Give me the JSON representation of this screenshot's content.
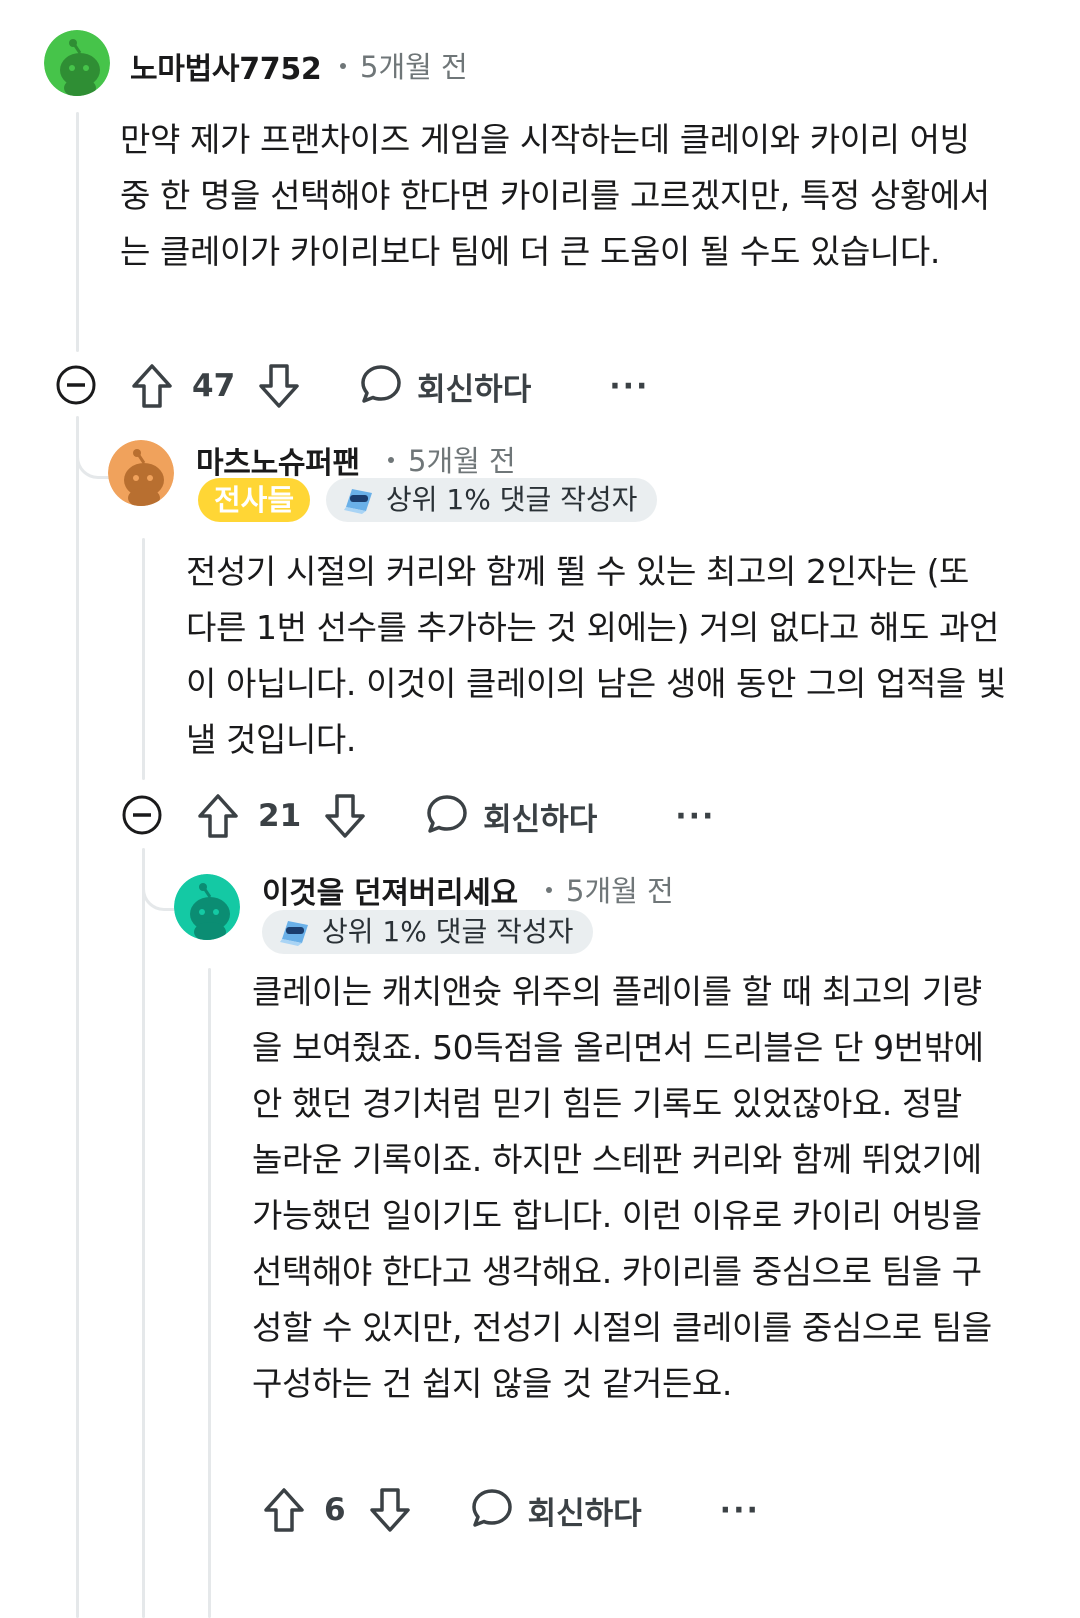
{
  "comments": [
    {
      "username": "노마법사7752",
      "time": "5개월 전",
      "body": "만약 제가 프랜차이즈 게임을 시작하는데 클레이와 카이리 어빙 중 한 명을 선택해야 한다면 카이리를 고르겠지만, 특정 상황에서는 클레이가 카이리보다 팀에 더 큰 도움이 될 수도 있습니다.",
      "votes": "47",
      "reply_label": "회신하다",
      "more_label": "···",
      "avatar_color": "#46c44a"
    },
    {
      "username": "마츠노슈퍼팬",
      "time": "5개월 전",
      "flair": "전사들",
      "badge": "상위 1% 댓글 작성자",
      "body": "전성기 시절의 커리와 함께 뛸 수 있는 최고의 2인자는 (또 다른 1번 선수를 추가하는 것 외에는) 거의 없다고 해도 과언이 아닙니다. 이것이 클레이의 남은 생애 동안 그의 업적을 빛낼 것입니다.",
      "votes": "21",
      "reply_label": "회신하다",
      "more_label": "···",
      "avatar_color": "#f0a25c"
    },
    {
      "username": "이것을 던져버리세요",
      "time": "5개월 전",
      "badge": "상위 1% 댓글 작성자",
      "body": "클레이는 캐치앤슛 위주의 플레이를 할 때 최고의 기량을 보여줬죠. 50득점을 올리면서 드리블은 단 9번밖에 안 했던 경기처럼 믿기 힘든 기록도 있었잖아요. 정말 놀라운 기록이죠. 하지만 스테판 커리와 함께 뛰었기에 가능했던 일이기도 합니다. 이런 이유로 카이리 어빙을 선택해야 한다고 생각해요. 카이리를 중심으로 팀을 구성할 수 있지만, 전성기 시절의 클레이를 중심으로 팀을 구성하는 건 쉽지 않을 것 같거든요.",
      "votes": "6",
      "reply_label": "회신하다",
      "more_label": "···",
      "avatar_color": "#14c9a4"
    }
  ],
  "colors": {
    "flair_bg": "#ffd635",
    "badge_bg": "#eaeef0",
    "thread_line": "#e5e8ea",
    "meta_text": "#6f7678"
  }
}
